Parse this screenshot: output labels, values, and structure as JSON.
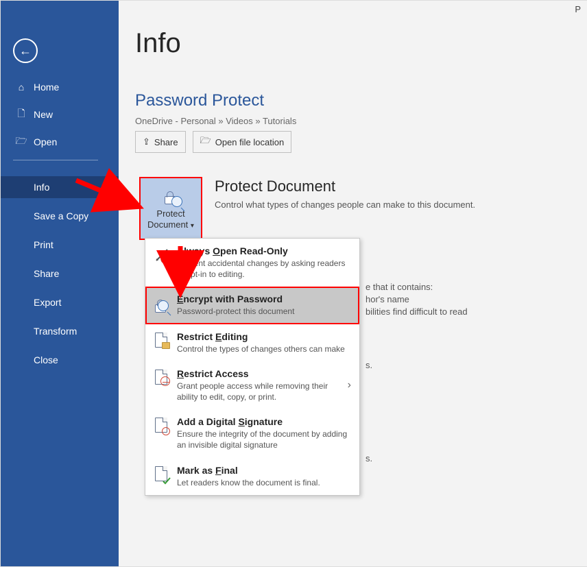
{
  "sidebar": {
    "items": [
      {
        "label": "Home"
      },
      {
        "label": "New"
      },
      {
        "label": "Open"
      },
      {
        "label": "Info"
      },
      {
        "label": "Save a Copy"
      },
      {
        "label": "Print"
      },
      {
        "label": "Share"
      },
      {
        "label": "Export"
      },
      {
        "label": "Transform"
      },
      {
        "label": "Close"
      }
    ]
  },
  "page": {
    "title": "Info",
    "doc_name": "Password Protect",
    "breadcrumb": "OneDrive - Personal » Videos » Tutorials",
    "share_label": "Share",
    "open_loc_label": "Open file location"
  },
  "protect_tile": {
    "line1": "Protect",
    "line2": "Document"
  },
  "section": {
    "title": "Protect Document",
    "desc": "Control what types of changes people can make to this document."
  },
  "menu": {
    "items": [
      {
        "title_pre": "Always ",
        "title_u": "O",
        "title_post": "pen Read-Only",
        "desc": "Prevent accidental changes by asking readers to opt-in to editing."
      },
      {
        "title_pre": "",
        "title_u": "E",
        "title_post": "ncrypt with Password",
        "desc": "Password-protect this document"
      },
      {
        "title_pre": "Restrict ",
        "title_u": "E",
        "title_post": "diting",
        "desc": "Control the types of changes others can make"
      },
      {
        "title_pre": "",
        "title_u": "R",
        "title_post": "estrict Access",
        "desc": "Grant people access while removing their ability to edit, copy, or print."
      },
      {
        "title_pre": "Add a Digital ",
        "title_u": "S",
        "title_post": "ignature",
        "desc": "Ensure the integrity of the document by adding an invisible digital signature"
      },
      {
        "title_pre": "Mark as ",
        "title_u": "F",
        "title_post": "inal",
        "desc": "Let readers know the document is final."
      }
    ]
  },
  "ghost": {
    "l1": "e that it contains:",
    "l2": "hor's name",
    "l3": "bilities find difficult to read",
    "l4": "s.",
    "l5": "s."
  },
  "top_right": "P"
}
